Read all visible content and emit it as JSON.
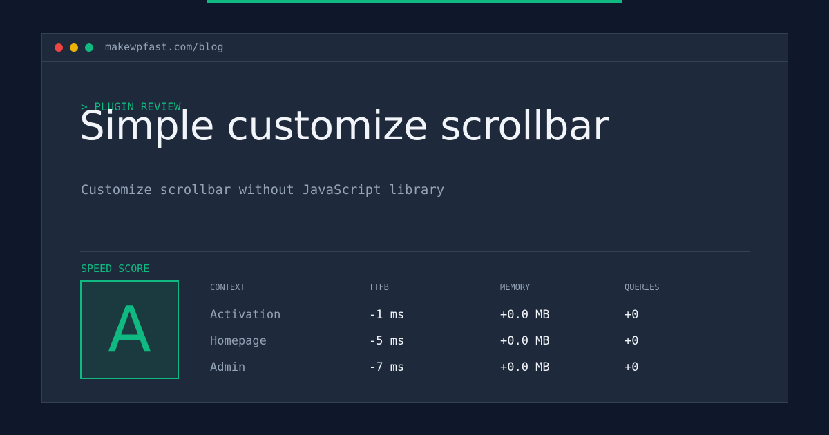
{
  "window": {
    "url": "makewpfast.com/blog"
  },
  "article": {
    "eyebrow": "> PLUGIN REVIEW",
    "title": "Simple customize scrollbar",
    "subtitle": "Customize scrollbar without JavaScript library"
  },
  "speed": {
    "label": "SPEED SCORE",
    "grade": "A"
  },
  "metrics": {
    "headers": [
      "CONTEXT",
      "TTFB",
      "MEMORY",
      "QUERIES"
    ],
    "rows": [
      {
        "context": "Activation",
        "ttfb": "-1 ms",
        "memory": "+0.0 MB",
        "queries": "+0"
      },
      {
        "context": "Homepage",
        "ttfb": "-5 ms",
        "memory": "+0.0 MB",
        "queries": "+0"
      },
      {
        "context": "Admin",
        "ttfb": "-7 ms",
        "memory": "+0.0 MB",
        "queries": "+0"
      }
    ]
  },
  "colors": {
    "accent": "#10b981",
    "background": "#0f172a",
    "panel": "#1e293b",
    "dot_red": "#ef4444",
    "dot_yellow": "#eab308",
    "dot_green": "#10b981"
  }
}
